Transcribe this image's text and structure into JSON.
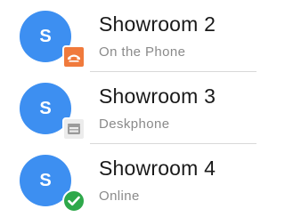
{
  "contacts": [
    {
      "initial": "S",
      "name": "Showroom 2",
      "status": "On the Phone",
      "presence_icon": "on-the-phone-icon",
      "presence_color": "#f07a3c"
    },
    {
      "initial": "S",
      "name": "Showroom 3",
      "status": "Deskphone",
      "presence_icon": "deskphone-icon",
      "presence_color": "#9a9a9a"
    },
    {
      "initial": "S",
      "name": "Showroom 4",
      "status": "Online",
      "presence_icon": "online-check-icon",
      "presence_color": "#2ea84a"
    }
  ],
  "colors": {
    "avatar": "#3d8ff1",
    "name_text": "#1a1a1a",
    "status_text": "#8a8a8a",
    "divider": "#d8d8d8"
  }
}
